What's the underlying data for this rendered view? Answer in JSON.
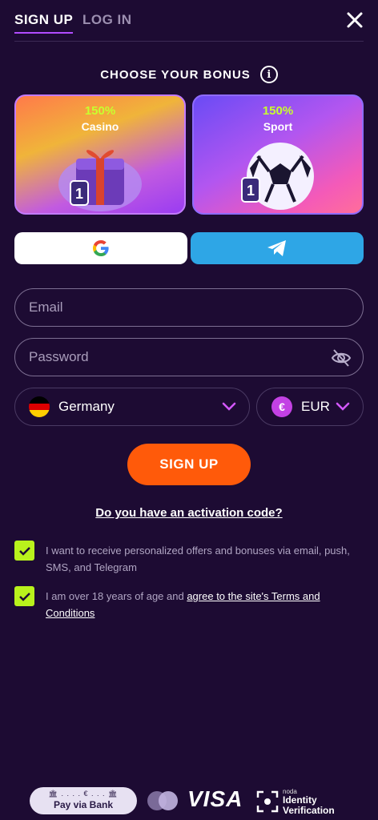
{
  "tabs": {
    "signup": "SIGN UP",
    "login": "LOG IN"
  },
  "bonus": {
    "title": "CHOOSE YOUR BONUS",
    "cards": [
      {
        "percent": "150%",
        "label": "Casino"
      },
      {
        "percent": "150%",
        "label": "Sport"
      }
    ]
  },
  "social": {
    "google_icon": "google-icon",
    "telegram_icon": "telegram-icon"
  },
  "form": {
    "email_placeholder": "Email",
    "password_placeholder": "Password",
    "country": "Germany",
    "currency": "EUR",
    "currency_symbol": "€",
    "submit_label": "SIGN UP",
    "activation_link": "Do you have an activation code?"
  },
  "consents": {
    "offers": "I want to receive personalized offers and bonuses via email, push, SMS, and Telegram",
    "age_prefix": "I am over 18 years of age and ",
    "terms_link": "agree to the site's Terms and Conditions",
    "offers_checked": true,
    "age_checked": true
  },
  "footer": {
    "pay_bank_symbol": "€",
    "pay_bank": "Pay via Bank",
    "visa": "VISA",
    "noda_small": "noda",
    "noda_line1": "Identity",
    "noda_line2": "Verification"
  },
  "colors": {
    "background": "#1d0b33",
    "accent_orange": "#ff5a0a",
    "check_green": "#b9f21c",
    "telegram_blue": "#2ea6e6",
    "purple": "#b14cff"
  }
}
